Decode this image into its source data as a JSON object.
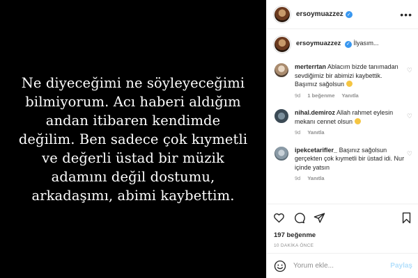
{
  "post_image": {
    "text": "Ne diyeceğimi ne söyleyeceğimi\nbilmiyorum. Acı haberi aldığım\nandan itibaren kendimde\ndeğilim. Ben sadece çok kıymetli\nve değerli üstad bir müzik\nadamını değil dostumu,\narkadaşımı, abimi kaybettim."
  },
  "header": {
    "username": "ersoymuazzez",
    "more_icon": "more-icon"
  },
  "caption": {
    "username": "ersoymuazzez",
    "text": "İlyasım..."
  },
  "comments": [
    {
      "username": "merterrtan",
      "text": "Ablacım bizde tanımadan sevdiğimiz bir abimizi kaybettik. Başımız sağolsun",
      "time": "9d",
      "likes": "1 beğenme",
      "reply": "Yanıtla"
    },
    {
      "username": "nihal.demiroz",
      "text": "Allah rahmet eylesin mekanı cennet olsun",
      "time": "9d",
      "reply": "Yanıtla"
    },
    {
      "username": "ipekcetarifler_",
      "text": "Başınız sağolsun gerçekten çok kıymetli bir üstad idi. Nur içinde yatsın",
      "time": "9d",
      "reply": "Yanıtla"
    }
  ],
  "actions": {
    "like_icon": "heart-icon",
    "comment_icon": "comment-icon",
    "share_icon": "share-icon",
    "save_icon": "bookmark-icon"
  },
  "likes": "197 beğenme",
  "time_ago": "10 DAKİKA ÖNCE",
  "add_comment": {
    "placeholder": "Yorum ekle...",
    "post_label": "Paylaş"
  },
  "colors": {
    "accent": "#3897f0",
    "post_disabled": "#b2dffc",
    "meta_gray": "#8e8e8e"
  }
}
